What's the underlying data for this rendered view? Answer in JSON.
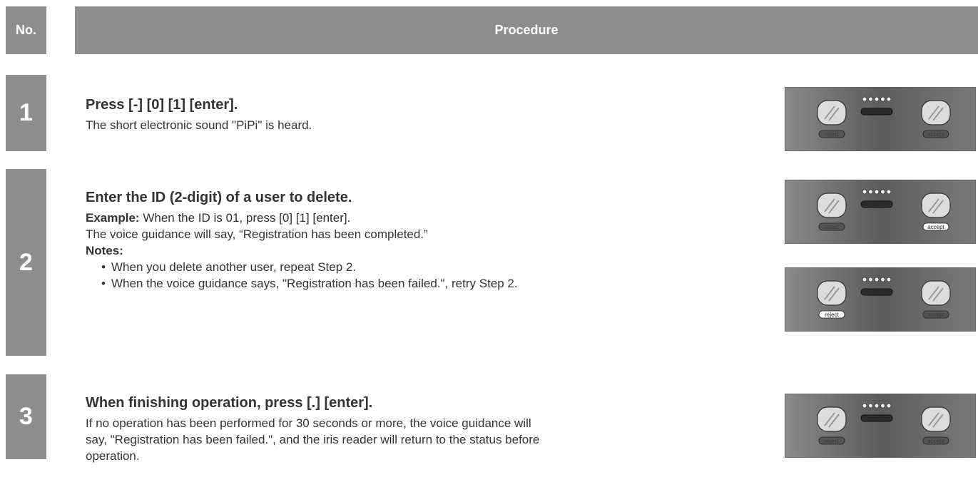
{
  "header": {
    "no": "No.",
    "procedure": "Procedure"
  },
  "steps": [
    {
      "number": "1",
      "title": "Press [-] [0] [1] [enter].",
      "lines": [
        "The short electronic sound \"PiPi\" is heard."
      ]
    },
    {
      "number": "2",
      "title": "Enter the ID (2-digit) of a user to delete.",
      "example_label": "Example:",
      "example_text": " When the ID is 01, press [0] [1] [enter].",
      "line2": "The voice guidance will say, “Registration has been completed.”",
      "notes_label": "Notes:",
      "notes": [
        "When you delete another user, repeat Step 2.",
        "When the voice guidance says, \"Registration has been failed.\", retry Step 2."
      ]
    },
    {
      "number": "3",
      "title": "When finishing operation, press [.] [enter].",
      "lines": [
        "If no operation has been performed for 30 seconds or more, the voice guidance will",
        "say, \"Registration has been failed.\", and the iris reader will return to the status before",
        "operation."
      ]
    }
  ],
  "panels": {
    "reject_label": "reject",
    "accept_label": "accept",
    "states": [
      {
        "reject_lit": false,
        "accept_lit": false
      },
      {
        "reject_lit": false,
        "accept_lit": true
      },
      {
        "reject_lit": true,
        "accept_lit": false
      },
      {
        "reject_lit": false,
        "accept_lit": false
      }
    ]
  },
  "colors": {
    "header_bg": "#8e8e8e",
    "number_bg": "#8e8e8e",
    "panel_bg": "#707070",
    "label_lit": "#ffffff",
    "label_dim": "#555555"
  }
}
